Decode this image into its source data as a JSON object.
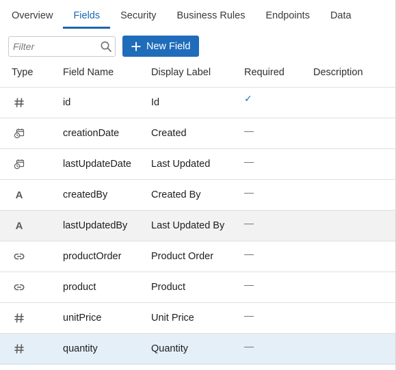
{
  "tabs": [
    {
      "label": "Overview",
      "active": false
    },
    {
      "label": "Fields",
      "active": true
    },
    {
      "label": "Security",
      "active": false
    },
    {
      "label": "Business Rules",
      "active": false
    },
    {
      "label": "Endpoints",
      "active": false
    },
    {
      "label": "Data",
      "active": false
    }
  ],
  "toolbar": {
    "filter_placeholder": "Filter",
    "new_field_label": "New Field"
  },
  "table": {
    "columns": [
      "Type",
      "Field Name",
      "Display Label",
      "Required",
      "Description"
    ],
    "rows": [
      {
        "type_icon": "number-icon",
        "name": "id",
        "label": "Id",
        "required": "✓",
        "description": ""
      },
      {
        "type_icon": "datetime-icon",
        "name": "creationDate",
        "label": "Created",
        "required": "—",
        "description": ""
      },
      {
        "type_icon": "datetime-icon",
        "name": "lastUpdateDate",
        "label": "Last Updated",
        "required": "—",
        "description": ""
      },
      {
        "type_icon": "text-icon",
        "name": "createdBy",
        "label": "Created By",
        "required": "—",
        "description": ""
      },
      {
        "type_icon": "text-icon",
        "name": "lastUpdatedBy",
        "label": "Last Updated By",
        "required": "—",
        "description": "",
        "state": "hover"
      },
      {
        "type_icon": "link-icon",
        "name": "productOrder",
        "label": "Product Order",
        "required": "—",
        "description": ""
      },
      {
        "type_icon": "link-icon",
        "name": "product",
        "label": "Product",
        "required": "—",
        "description": ""
      },
      {
        "type_icon": "number-icon",
        "name": "unitPrice",
        "label": "Unit Price",
        "required": "—",
        "description": ""
      },
      {
        "type_icon": "number-icon",
        "name": "quantity",
        "label": "Quantity",
        "required": "—",
        "description": "",
        "state": "selected"
      }
    ]
  },
  "colors": {
    "accent": "#1f6cbb",
    "active_tab": "#1a67b0",
    "hover_row": "#f2f2f2",
    "selected_row": "#e4eff8"
  }
}
